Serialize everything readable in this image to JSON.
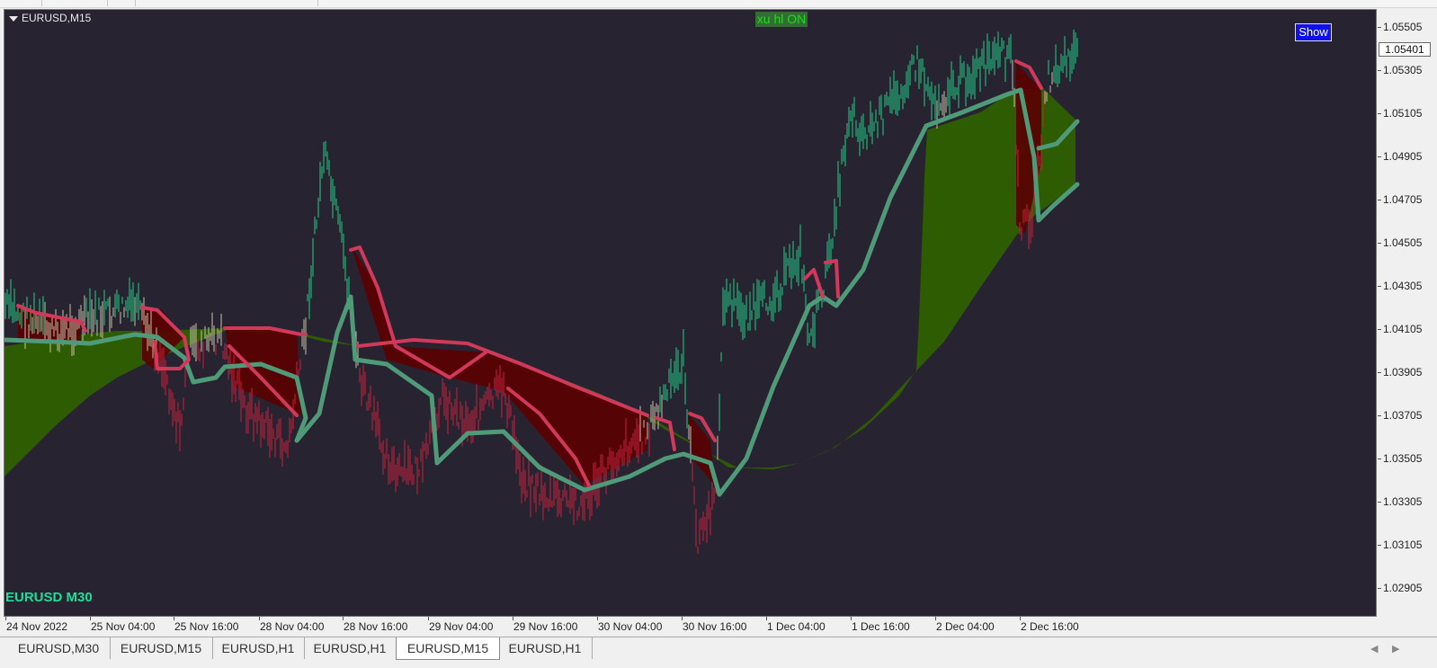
{
  "chart": {
    "title": "EURUSD,M15",
    "indicator_label": "xu hl ON",
    "show_button": "Show",
    "watermark": "EURUSD M30",
    "current_price": "1.05401",
    "price_labels": [
      "1.05505",
      "1.05305",
      "1.05105",
      "1.04905",
      "1.04705",
      "1.04505",
      "1.04305",
      "1.04105",
      "1.03905",
      "1.03705",
      "1.03505",
      "1.03305",
      "1.03105",
      "1.02905"
    ],
    "time_labels": [
      "24 Nov 2022",
      "25 Nov 04:00",
      "25 Nov 16:00",
      "28 Nov 04:00",
      "28 Nov 16:00",
      "29 Nov 04:00",
      "29 Nov 16:00",
      "30 Nov 04:00",
      "30 Nov 16:00",
      "1 Dec 04:00",
      "1 Dec 16:00",
      "2 Dec 04:00",
      "2 Dec 16:00"
    ],
    "colors": {
      "background": "#282331",
      "bull_band": "#2e6000",
      "bear_band": "#5a0000",
      "bull_line": "#4f9a78",
      "bear_line": "#d2385a",
      "bull_bar": "#1fcf88",
      "bear_bar": "#c8203e",
      "neutral_bar": "#c8c0a8"
    }
  },
  "tabs": [
    "EURUSD,M30",
    "EURUSD,M15",
    "EURUSD,H1",
    "EURUSD,H1",
    "EURUSD,M15",
    "EURUSD,H1"
  ],
  "active_tab": 4
}
